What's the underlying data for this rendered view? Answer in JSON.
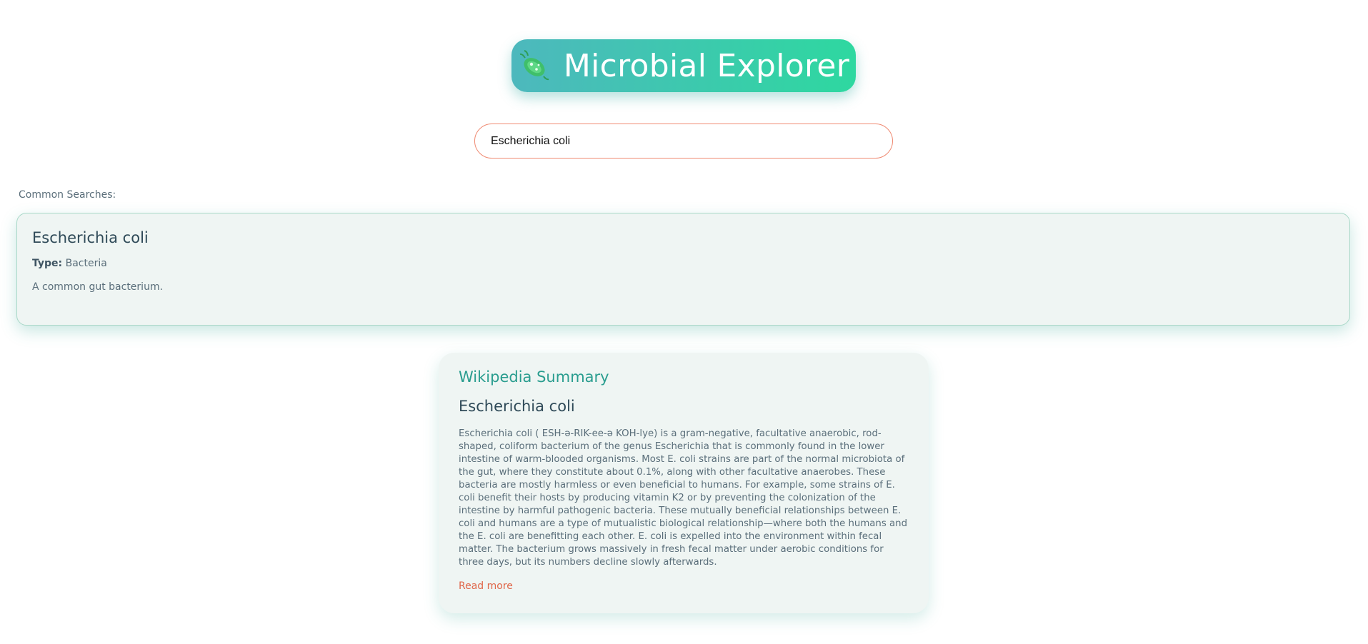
{
  "header": {
    "title": "Microbial Explorer",
    "logo_icon": "microbe-icon",
    "gradient_start": "#4db8bd",
    "gradient_end": "#2ed8a0"
  },
  "search": {
    "value": "Escherichia coli",
    "border_color": "#ef8a72"
  },
  "common_searches": {
    "label": "Common Searches:"
  },
  "result": {
    "name": "Escherichia coli",
    "type_label": "Type:",
    "type_value": "Bacteria",
    "description": "A common gut bacterium."
  },
  "wikipedia": {
    "heading": "Wikipedia Summary",
    "title": "Escherichia coli",
    "summary": "Escherichia coli ( ESH-ə-RIK-ee-ə KOH-lye) is a gram-negative, facultative anaerobic, rod-shaped, coliform bacterium of the genus Escherichia that is commonly found in the lower intestine of warm-blooded organisms. Most E. coli strains are part of the normal microbiota of the gut, where they constitute about 0.1%, along with other facultative anaerobes. These bacteria are mostly harmless or even beneficial to humans. For example, some strains of E. coli benefit their hosts by producing vitamin K2 or by preventing the colonization of the intestine by harmful pathogenic bacteria. These mutually beneficial relationships between E. coli and humans are a type of mutualistic biological relationship—where both the humans and the E. coli are benefitting each other. E. coli is expelled into the environment within fecal matter. The bacterium grows massively in fresh fecal matter under aerobic conditions for three days, but its numbers decline slowly afterwards.",
    "read_more": "Read more",
    "accent_color": "#2a9d8f",
    "link_color": "#e0674a"
  }
}
